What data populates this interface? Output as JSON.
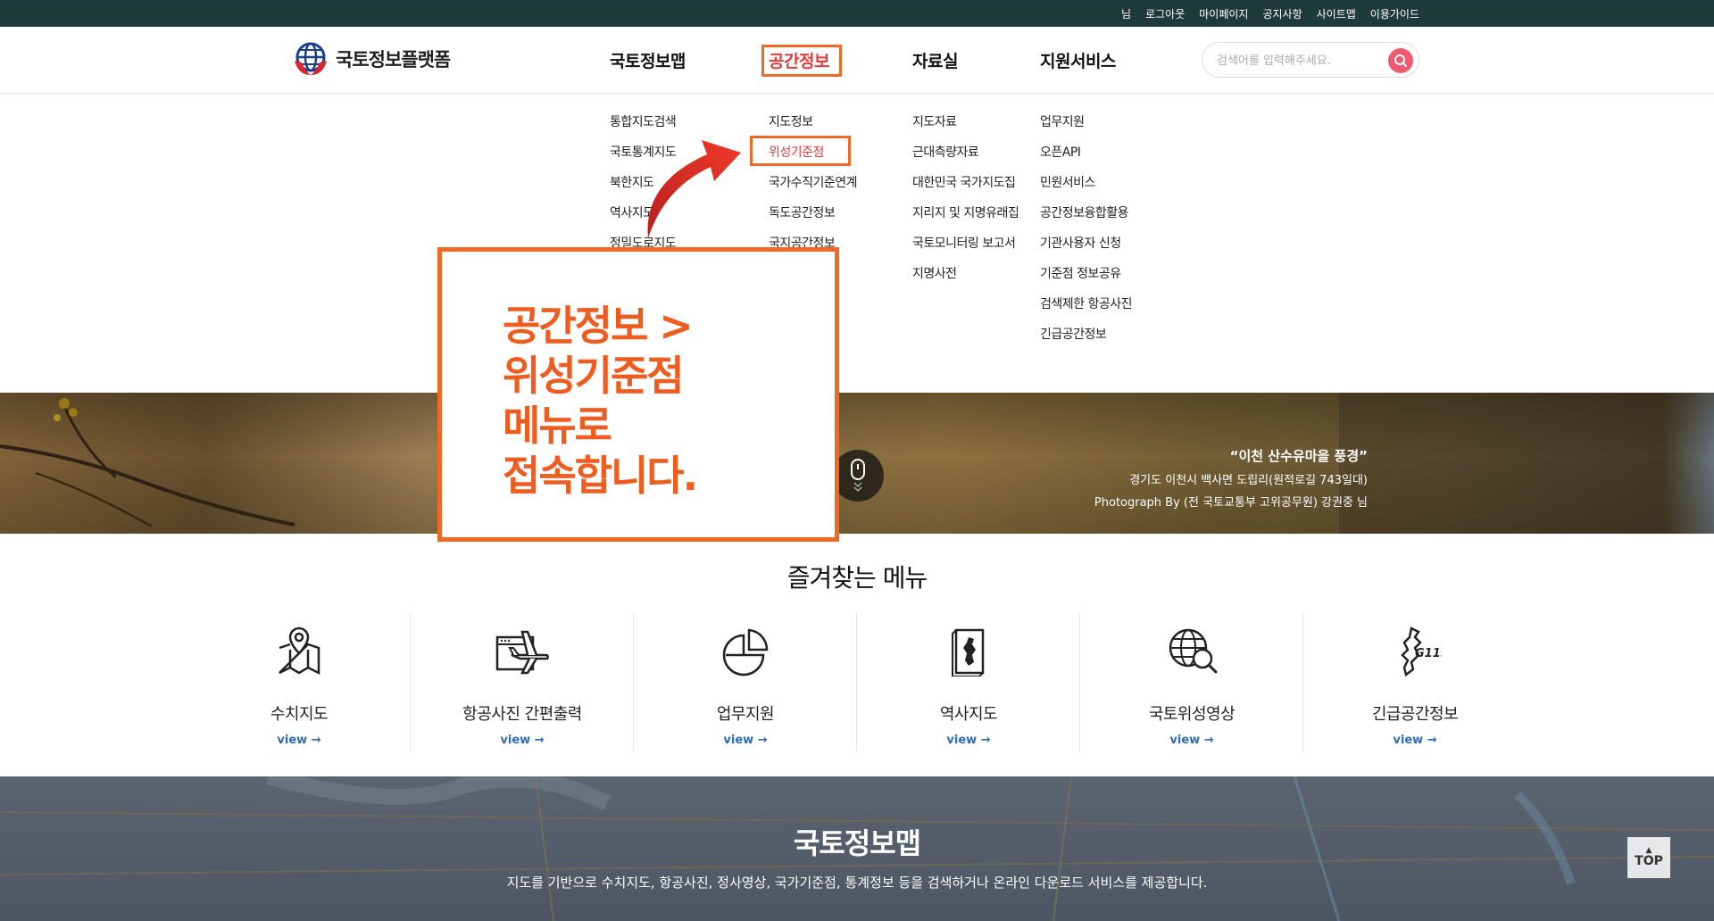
{
  "util": {
    "user_suffix": "님",
    "logout": "로그아웃",
    "mypage": "마이페이지",
    "notice": "공지사항",
    "sitemap": "사이트맵",
    "guide": "이용가이드"
  },
  "header": {
    "logo_text": "국토정보플랫폼",
    "search_placeholder": "검색어를 입력해주세요."
  },
  "gnb": [
    {
      "label": "국토정보맵"
    },
    {
      "label": "공간정보"
    },
    {
      "label": "자료실"
    },
    {
      "label": "지원서비스"
    }
  ],
  "mega": {
    "col1": [
      "통합지도검색",
      "국토통계지도",
      "북한지도",
      "역사지도",
      "정밀도로지도"
    ],
    "col2": [
      "지도정보",
      "위성기준점",
      "국가수직기준연계",
      "독도공간정보",
      "국지공간정보"
    ],
    "col3": [
      "지도자료",
      "근대측량자료",
      "대한민국 국가지도집",
      "지리지 및 지명유래집",
      "국토모니터링 보고서",
      "지명사전"
    ],
    "col4": [
      "업무지원",
      "오픈API",
      "민원서비스",
      "공간정보융합활용",
      "기관사용자 신청",
      "기준점 정보공유",
      "검색제한 항공사진",
      "긴급공간정보"
    ]
  },
  "annotation": {
    "lines": [
      "공간정보 >",
      "위성기준점",
      "메뉴로",
      "접속합니다."
    ]
  },
  "hero": {
    "caption_title": "“이천 산수유마을 풍경”",
    "caption_location": "경기도 이천시 백사면 도립리(원적로길 743일대)",
    "caption_credit": "Photograph By (전 국토교통부 고위공무원) 강권중 님"
  },
  "favorites": {
    "title": "즐겨찾는 메뉴",
    "items": [
      {
        "label": "수치지도",
        "view": "view →",
        "icon": "map-pin-icon"
      },
      {
        "label": "항공사진 간편출력",
        "view": "view →",
        "icon": "airplane-icon"
      },
      {
        "label": "업무지원",
        "view": "view →",
        "icon": "pie-chart-icon"
      },
      {
        "label": "역사지도",
        "view": "view →",
        "icon": "korea-map-icon"
      },
      {
        "label": "국토위성영상",
        "view": "view →",
        "icon": "globe-search-icon"
      },
      {
        "label": "긴급공간정보",
        "view": "view →",
        "icon": "emergency-map-icon"
      }
    ]
  },
  "mapsection": {
    "title": "국토정보맵",
    "description": "지도를 기반으로 수치지도, 항공사진, 정사영상, 국가기준점, 통계정보 등을 검색하거나 온라인 다운로드 서비스를 제공합니다.",
    "top_label": "TOP"
  },
  "colors": {
    "accent_orange": "#ee6a24",
    "active_red": "#e63b3b",
    "util_bar": "#1e3b3a",
    "link_blue": "#2e6bb5"
  }
}
